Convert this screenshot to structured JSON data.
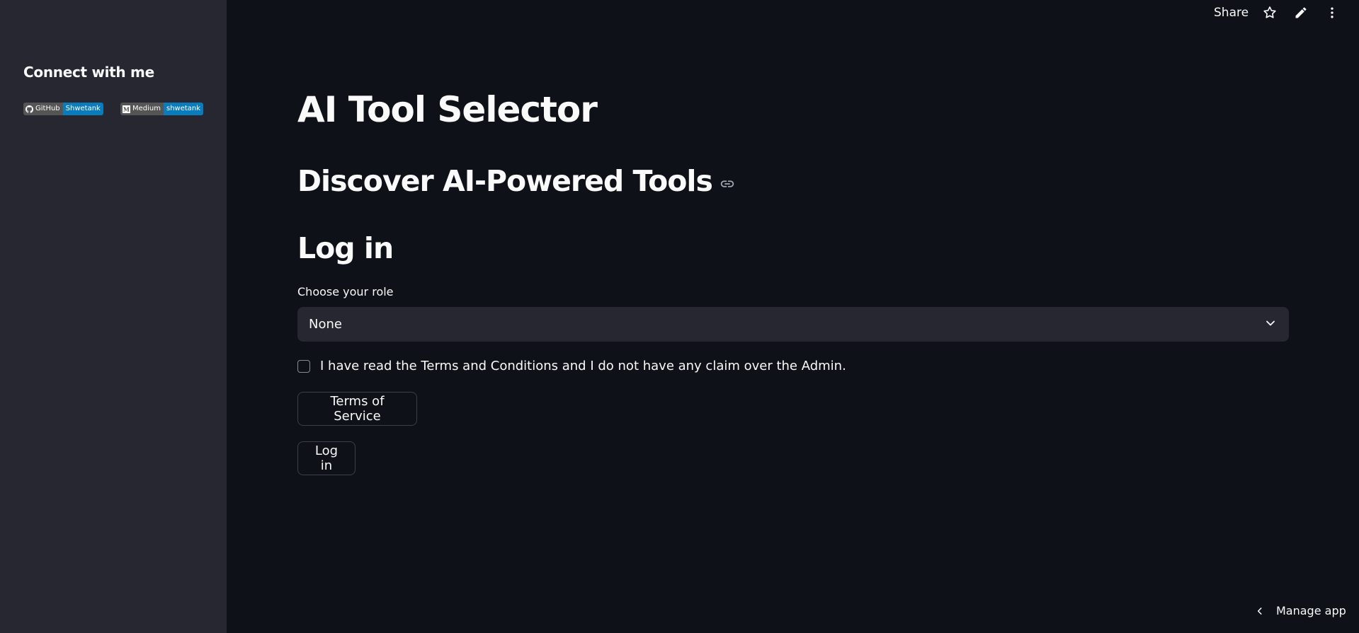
{
  "sidebar": {
    "title": "Connect with me",
    "badges": [
      {
        "left_label": "GitHub",
        "right_label": "Shwetank",
        "icon": "github-icon"
      },
      {
        "left_label": "Medium",
        "right_label": "shwetank",
        "icon": "medium-icon"
      }
    ]
  },
  "topbar": {
    "share_label": "Share",
    "icons": [
      "star-icon",
      "pencil-icon",
      "more-vertical-icon"
    ]
  },
  "main": {
    "title": "AI Tool Selector",
    "subtitle": "Discover AI-Powered Tools",
    "section_title": "Log in",
    "role_select": {
      "label": "Choose your role",
      "value": "None"
    },
    "terms_checkbox": {
      "label": "I have read the Terms and Conditions and I do not have any claim over the Admin.",
      "checked": false
    },
    "terms_button_label": "Terms of Service",
    "login_button_label": "Log in"
  },
  "footer": {
    "manage_app_label": "Manage app"
  },
  "colors": {
    "background": "#0e1117",
    "sidebar": "#262730",
    "text": "#fafafa",
    "badge_left": "#555555",
    "badge_right": "#0a7bbb"
  }
}
